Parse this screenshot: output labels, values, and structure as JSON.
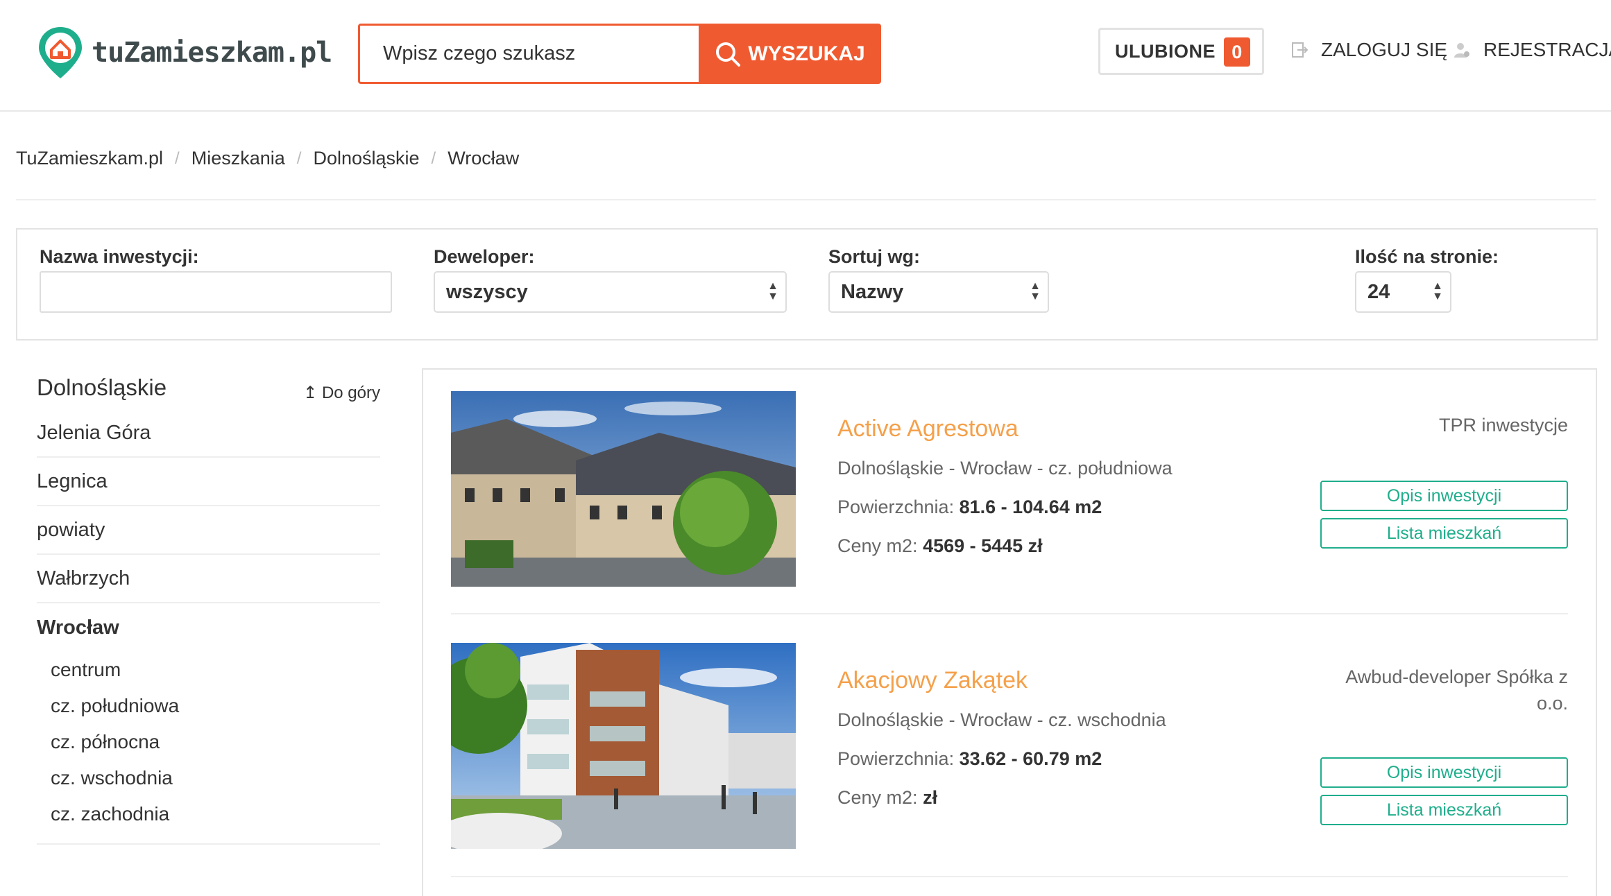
{
  "header": {
    "logo_text": "tuZamieszkam.pl",
    "search_placeholder": "Wpisz czego szukasz",
    "search_button": "WYSZUKAJ",
    "favorites_label": "ULUBIONE",
    "favorites_count": "0",
    "login_label": "ZALOGUJ SIĘ",
    "register_label": "REJESTRACJA"
  },
  "breadcrumb": [
    "TuZamieszkam.pl",
    "Mieszkania",
    "Dolnośląskie",
    "Wrocław"
  ],
  "filters": {
    "name_label": "Nazwa inwestycji:",
    "name_value": "",
    "developer_label": "Deweloper:",
    "developer_value": "wszyscy",
    "sort_label": "Sortuj wg:",
    "sort_value": "Nazwy",
    "per_page_label": "Ilość na stronie:",
    "per_page_value": "24"
  },
  "sidebar": {
    "title": "Dolnośląskie",
    "top_link": "Do góry",
    "items": [
      "Jelenia Góra",
      "Legnica",
      "powiaty",
      "Wałbrzych"
    ],
    "active": "Wrocław",
    "subitems": [
      "centrum",
      "cz. południowa",
      "cz. północna",
      "cz. wschodnia",
      "cz. zachodnia"
    ]
  },
  "listings": [
    {
      "title": "Active Agrestowa",
      "location": "Dolnośląskie - Wrocław - cz. południowa",
      "area_label": "Powierzchnia:",
      "area_value": "81.6 - 104.64 m2",
      "price_label": "Ceny m2:",
      "price_value": "4569 - 5445 zł",
      "developer": "TPR inwestycje",
      "btn_description": "Opis inwestycji",
      "btn_list": "Lista mieszkań"
    },
    {
      "title": "Akacjowy Zakątek",
      "location": "Dolnośląskie - Wrocław - cz. wschodnia",
      "area_label": "Powierzchnia:",
      "area_value": "33.62 - 60.79 m2",
      "price_label": "Ceny m2:",
      "price_value": "zł",
      "developer": "Awbud-developer Spółka z o.o.",
      "btn_description": "Opis inwestycji",
      "btn_list": "Lista mieszkań"
    }
  ],
  "colors": {
    "accent_orange": "#f05a30",
    "title_orange": "#f5a04a",
    "button_green": "#1fae8c",
    "logo_green": "#1fae8c"
  }
}
